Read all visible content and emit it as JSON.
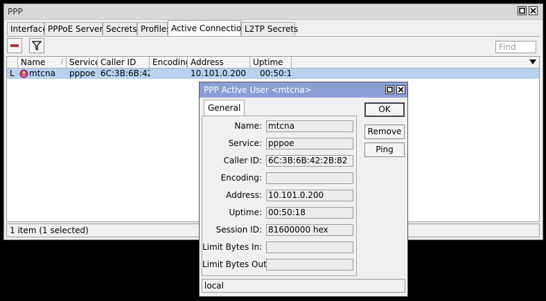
{
  "window": {
    "title": "PPP"
  },
  "tabs": [
    {
      "label": "Interface"
    },
    {
      "label": "PPPoE Servers"
    },
    {
      "label": "Secrets"
    },
    {
      "label": "Profiles"
    },
    {
      "label": "Active Connections"
    },
    {
      "label": "L2TP Secrets"
    }
  ],
  "toolbar": {
    "find_placeholder": "Find"
  },
  "table": {
    "columns": [
      "Name",
      "Service",
      "Caller ID",
      "Encoding",
      "Address",
      "Uptime"
    ],
    "rows": [
      {
        "flag": "L",
        "name": "mtcna",
        "service": "pppoe",
        "caller_id": "6C:3B:6B:42...",
        "encoding": "",
        "address": "10.101.0.200",
        "uptime": "00:50:18"
      }
    ]
  },
  "status": {
    "text": "1 item (1 selected)"
  },
  "dialog": {
    "title": "PPP Active User <mtcna>",
    "tab": "General",
    "fields": [
      {
        "label": "Name:",
        "value": "mtcna"
      },
      {
        "label": "Service:",
        "value": "pppoe"
      },
      {
        "label": "Caller ID:",
        "value": "6C:3B:6B:42:2B:82"
      },
      {
        "label": "Encoding:",
        "value": ""
      },
      {
        "label": "Address:",
        "value": "10.101.0.200"
      },
      {
        "label": "Uptime:",
        "value": "00:50:18"
      },
      {
        "label": "Session ID:",
        "value": "81600000 hex"
      },
      {
        "label": "Limit Bytes In:",
        "value": ""
      },
      {
        "label": "Limit Bytes Out:",
        "value": ""
      }
    ],
    "buttons": {
      "ok": "OK",
      "remove": "Remove",
      "ping": "Ping"
    },
    "status": "local"
  },
  "colors": {
    "selected_row": "#b7d1ee",
    "dialog_titlebar": "#8b9fd7",
    "remove_icon": "#b0303a"
  }
}
